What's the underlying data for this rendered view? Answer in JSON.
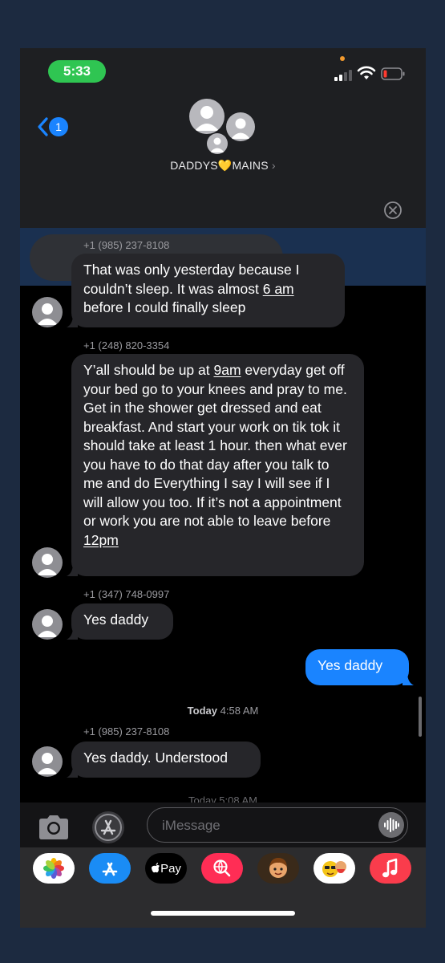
{
  "status": {
    "time": "5:33"
  },
  "header": {
    "back_count": "1",
    "group_name_left": "DADDYS",
    "group_name_heart": "💛",
    "group_name_right": "MAINS",
    "chevron": "›"
  },
  "messages": [
    {
      "sender": "+1 (985) 237-8108",
      "text_parts": [
        "That was only yesterday because I couldn’t sleep. It was almost ",
        "6 am",
        " before I could finally sleep"
      ]
    },
    {
      "sender": "+1 (248) 820-3354",
      "text_parts": [
        "Y’all should be up at ",
        "9am",
        " everyday get off your bed go to your knees and pray to me. Get in the shower get dressed and eat breakfast. And start your work on tik tok it should take at least 1 hour. then what ever you have to do that day after you talk to me and do Everything I say I will see if I will allow you too. If it’s not a appointment or work you are not able to leave before ",
        "12pm",
        ""
      ]
    },
    {
      "sender": "+1 (347) 748-0997",
      "text": "Yes daddy"
    },
    {
      "outgoing": true,
      "text": "Yes daddy"
    },
    {
      "timestamp_day": "Today",
      "timestamp_time": "4:58 AM"
    },
    {
      "sender": "+1 (985) 237-8108",
      "text": "Yes daddy. Understood"
    },
    {
      "timestamp_partial": "Today 5:08 AM"
    }
  ],
  "input": {
    "placeholder": "iMessage"
  },
  "icons": {
    "camera": "camera-icon",
    "apps": "app-store-icon",
    "audio": "waveform-icon",
    "photos": "photos-app-icon",
    "appstore": "app-store-app-icon",
    "applepay": "apple-pay-app-icon",
    "images": "images-search-app-icon",
    "memoji": "memoji-app-icon",
    "animoji": "animoji-stickers-app-icon",
    "music": "music-app-icon"
  },
  "apple_pay_label": "Pay",
  "colors": {
    "outgoing_bubble": "#1a84ff",
    "incoming_bubble": "#26262a",
    "time_pill": "#2fc552",
    "banner": "#1a3050",
    "battery_low": "#ff3b30",
    "privacy_dot": "#f29a2e"
  }
}
